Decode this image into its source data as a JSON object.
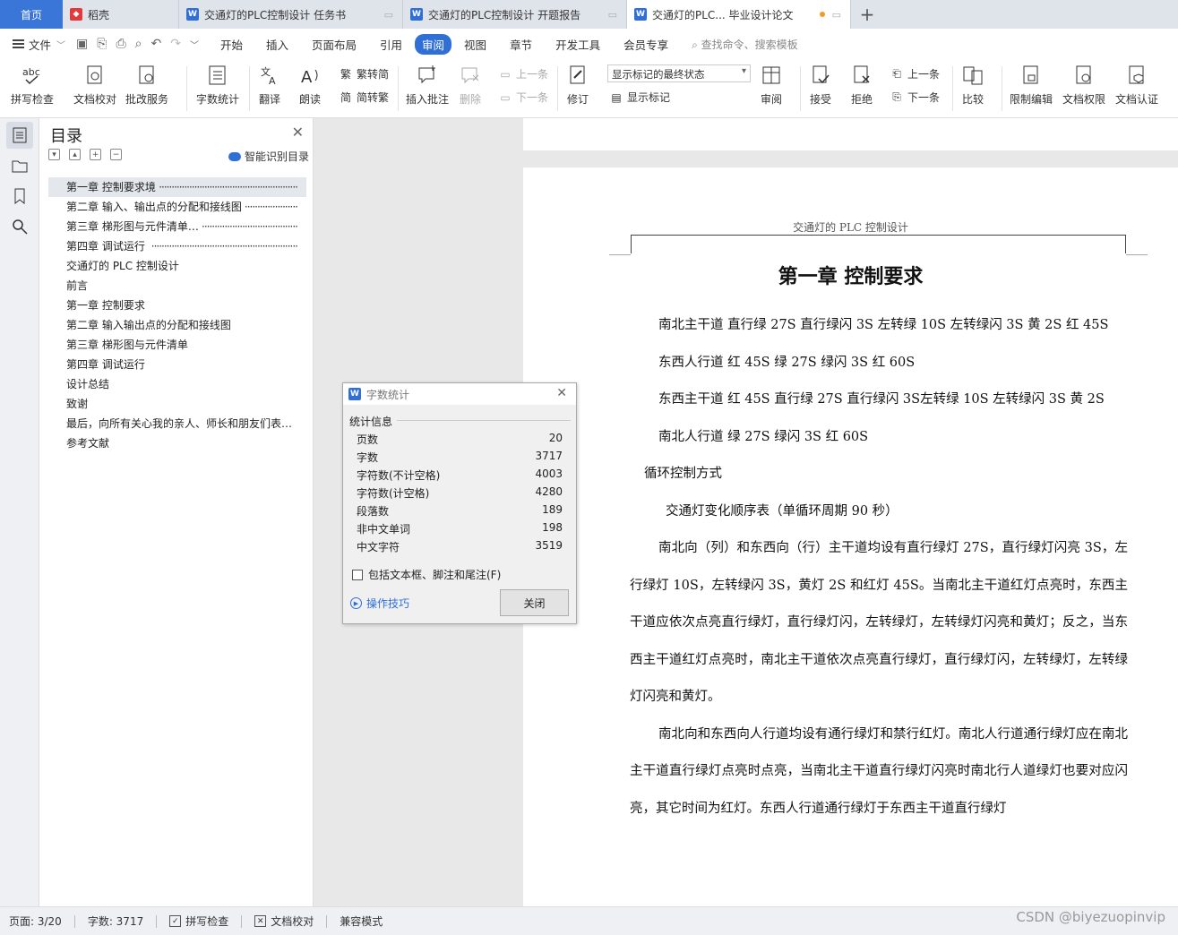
{
  "tabs": {
    "home": "首页",
    "items": [
      {
        "label": "稻壳",
        "icon": "daoke-icon"
      },
      {
        "label": "交通灯的PLC控制设计 任务书",
        "icon": "wps-doc-icon"
      },
      {
        "label": "交通灯的PLC控制设计 开题报告",
        "icon": "wps-doc-icon"
      },
      {
        "label": "交通灯的PLC... 毕业设计论文",
        "icon": "wps-doc-icon"
      }
    ],
    "add": "+"
  },
  "menu": {
    "file": "文件",
    "items": [
      "开始",
      "插入",
      "页面布局",
      "引用",
      "审阅",
      "视图",
      "章节",
      "开发工具",
      "会员专享"
    ],
    "selected": "审阅",
    "search": "查找命令、搜索模板"
  },
  "ribbon": {
    "spell": "拼写检查",
    "proof": "文档校对",
    "review_service": "批改服务",
    "word_count": "字数统计",
    "translate": "翻译",
    "read": "朗读",
    "to_trad": "繁转简",
    "to_simp": "简转繁",
    "insert_comment": "插入批注",
    "delete": "删除",
    "prev_comment": "上一条",
    "next_comment": "下一条",
    "revise": "修订",
    "markup_state": "显示标记的最终状态",
    "show_markup": "显示标记",
    "review": "审阅",
    "accept": "接受",
    "reject": "拒绝",
    "prev": "上一条",
    "next": "下一条",
    "compare": "比较",
    "restrict": "限制编辑",
    "permission": "文档权限",
    "certify": "文档认证"
  },
  "nav": {
    "title": "目录",
    "smart": "智能识别目录",
    "toc": [
      {
        "text": "第一章  控制要求境",
        "dots": true
      },
      {
        "text": "第二章  输入、输出点的分配和接线图",
        "dots": true
      },
      {
        "text": "第三章  梯形图与元件清单…",
        "dots": true
      },
      {
        "text": "第四章  调试运行",
        "dots": true
      },
      {
        "text": "交通灯的 PLC 控制设计",
        "dots": false
      },
      {
        "text": "前言",
        "dots": false
      },
      {
        "text": "第一章  控制要求",
        "dots": false
      },
      {
        "text": "第二章  输入输出点的分配和接线图",
        "dots": false
      },
      {
        "text": "第三章  梯形图与元件清单",
        "dots": false
      },
      {
        "text": "第四章  调试运行",
        "dots": false
      },
      {
        "text": "设计总结",
        "dots": false
      },
      {
        "text": "致谢",
        "dots": false
      },
      {
        "text": "最后，向所有关心我的亲人、师长和朋友们表…",
        "dots": false
      },
      {
        "text": "参考文献",
        "dots": false
      }
    ]
  },
  "doc": {
    "header": "交通灯的 PLC 控制设计",
    "heading": "第一章  控制要求",
    "paragraphs": [
      "南北主干道  直行绿  27S 直行绿闪 3S 左转绿  10S  左转绿闪  3S  黄  2S  红 45S",
      "东西人行道  红  45S 绿  27S  绿闪 3S  红  60S",
      "东西主干道  红  45S  直行绿  27S  直行绿闪 3S左转绿  10S  左转绿闪  3S  黄 2S",
      "南北人行道  绿 27S  绿闪 3S 红  60S",
      "循环控制方式",
      "交通灯变化顺序表（单循环周期 90 秒）",
      "南北向（列）和东西向（行）主干道均设有直行绿灯 27S，直行绿灯闪亮 3S，左行绿灯 10S，左转绿闪 3S，黄灯 2S 和红灯 45S。当南北主干道红灯点亮时，东西主干道应依次点亮直行绿灯，直行绿灯闪，左转绿灯，左转绿灯闪亮和黄灯；反之，当东西主干道红灯点亮时，南北主干道依次点亮直行绿灯，直行绿灯闪，左转绿灯，左转绿灯闪亮和黄灯。",
      "南北向和东西向人行道均设有通行绿灯和禁行红灯。南北人行道通行绿灯应在南北主干道直行绿灯点亮时点亮，当南北主干道直行绿灯闪亮时南北行人道绿灯也要对应闪亮，其它时间为红灯。东西人行道通行绿灯于东西主干道直行绿灯"
    ]
  },
  "dialog": {
    "title": "字数统计",
    "group": "统计信息",
    "stats": [
      {
        "label": "页数",
        "value": "20"
      },
      {
        "label": "字数",
        "value": "3717"
      },
      {
        "label": "字符数(不计空格)",
        "value": "4003"
      },
      {
        "label": "字符数(计空格)",
        "value": "4280"
      },
      {
        "label": "段落数",
        "value": "189"
      },
      {
        "label": "非中文单词",
        "value": "198"
      },
      {
        "label": "中文字符",
        "value": "3519"
      }
    ],
    "checkbox": "包括文本框、脚注和尾注(F)",
    "tips": "操作技巧",
    "close": "关闭"
  },
  "status": {
    "page": "页面: 3/20",
    "words": "字数: 3717",
    "spell": "拼写检查",
    "proof": "文档校对",
    "compat": "兼容模式"
  },
  "watermark": "CSDN @biyezuopinvip",
  "colors": {
    "accent": "#2f6fd6",
    "home_tab": "#3a75d8",
    "modified_dot": "#f09a2a"
  }
}
